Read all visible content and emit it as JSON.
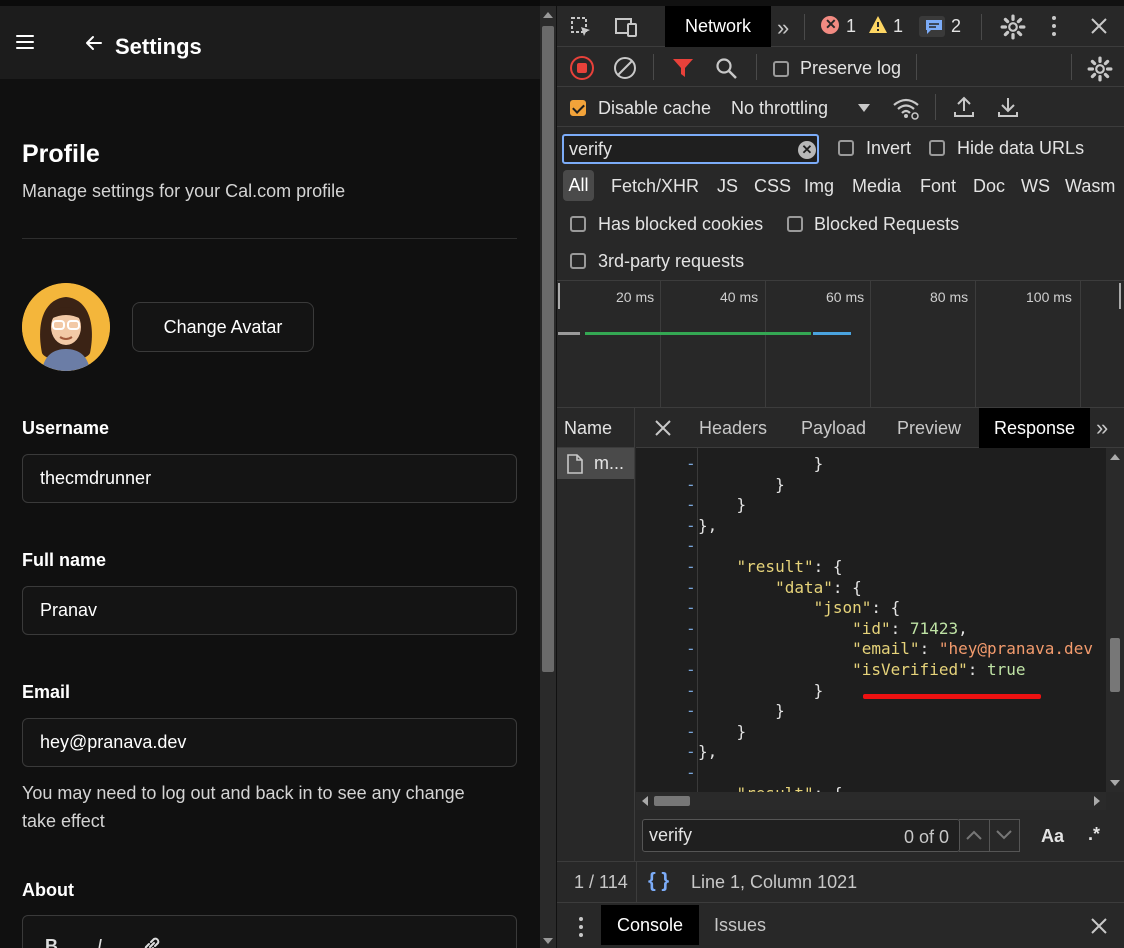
{
  "app": {
    "header_title": "Settings",
    "profile_title": "Profile",
    "profile_subtitle": "Manage settings for your Cal.com profile",
    "change_avatar_label": "Change Avatar",
    "username_label": "Username",
    "username_value": "thecmdrunner",
    "fullname_label": "Full name",
    "fullname_value": "Pranav",
    "email_label": "Email",
    "email_value": "hey@pranava.dev",
    "email_hint": "You may need to log out and back in to see any change take effect",
    "about_label": "About",
    "editor_bold": "B",
    "editor_italic": "I"
  },
  "devtools": {
    "active_panel": "Network",
    "errors_count": "1",
    "warnings_count": "1",
    "messages_count": "2",
    "preserve_log_label": "Preserve log",
    "disable_cache_label": "Disable cache",
    "throttling_value": "No throttling",
    "filter_value": "verify",
    "invert_label": "Invert",
    "hide_data_urls_label": "Hide data URLs",
    "type_filters": [
      "All",
      "Fetch/XHR",
      "JS",
      "CSS",
      "Img",
      "Media",
      "Font",
      "Doc",
      "WS",
      "Wasm"
    ],
    "has_blocked_cookies_label": "Has blocked cookies",
    "blocked_requests_label": "Blocked Requests",
    "third_party_label": "3rd-party requests",
    "timeline_ticks": [
      "20 ms",
      "40 ms",
      "60 ms",
      "80 ms",
      "100 ms"
    ],
    "name_header": "Name",
    "request_name": "m...",
    "detail_tabs": [
      "Headers",
      "Payload",
      "Preview",
      "Response"
    ],
    "active_detail_tab": "Response",
    "search_value": "verify",
    "search_count": "0 of 0",
    "match_case_label": "Aa",
    "regex_label": ".*",
    "request_count": "1 / 114",
    "cursor_position": "Line 1, Column 1021",
    "drawer_tabs": [
      "Console",
      "Issues"
    ],
    "code_lines": [
      "            }",
      "        }",
      "    }",
      "},",
      "",
      "    \"result\": {",
      "        \"data\": {",
      "            \"json\": {",
      "                \"id\": 71423,",
      "                \"email\": \"hey@pranava.dev",
      "                \"isVerified\": true",
      "            }",
      "        }",
      "    }",
      "},",
      "",
      "    \"result\": {"
    ]
  },
  "colors": {
    "accent_orange": "#f2a33a",
    "filter_active_red": "#e8413a",
    "highlight_underline": "#ee1111",
    "code_key": "#e6d37a",
    "code_number": "#bfe3a5",
    "code_string": "#f39b6d"
  }
}
